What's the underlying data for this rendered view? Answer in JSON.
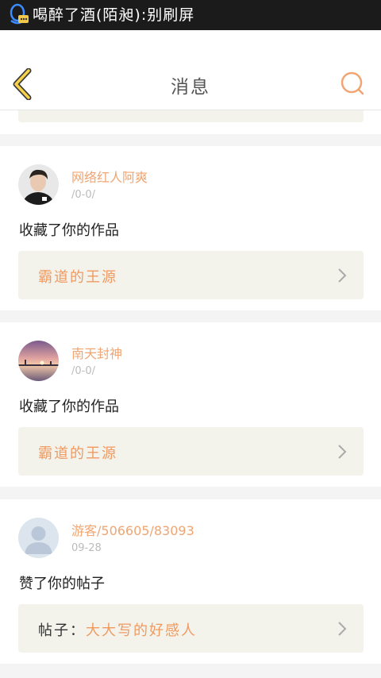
{
  "status_bar": {
    "title": "喝醉了酒(陌昶):别刷屏",
    "icon": "qq-penguin-icon"
  },
  "header": {
    "title": "消息",
    "back_icon": "back-chevron-icon",
    "search_icon": "search-icon",
    "accent_color": "#f0a572"
  },
  "messages": [
    {
      "user": "网络红人阿爽",
      "time": "/0-0/",
      "action": "收藏了你的作品",
      "target": "霸道的王源",
      "target_prefix": ""
    },
    {
      "user": "南天封神",
      "time": "/0-0/",
      "action": "收藏了你的作品",
      "target": "霸道的王源",
      "target_prefix": ""
    },
    {
      "user": "游客/506605/83093",
      "time": "09-28",
      "action": "赞了你的帖子",
      "target_prefix": "帖子：",
      "target": "大大写的好感人"
    }
  ]
}
